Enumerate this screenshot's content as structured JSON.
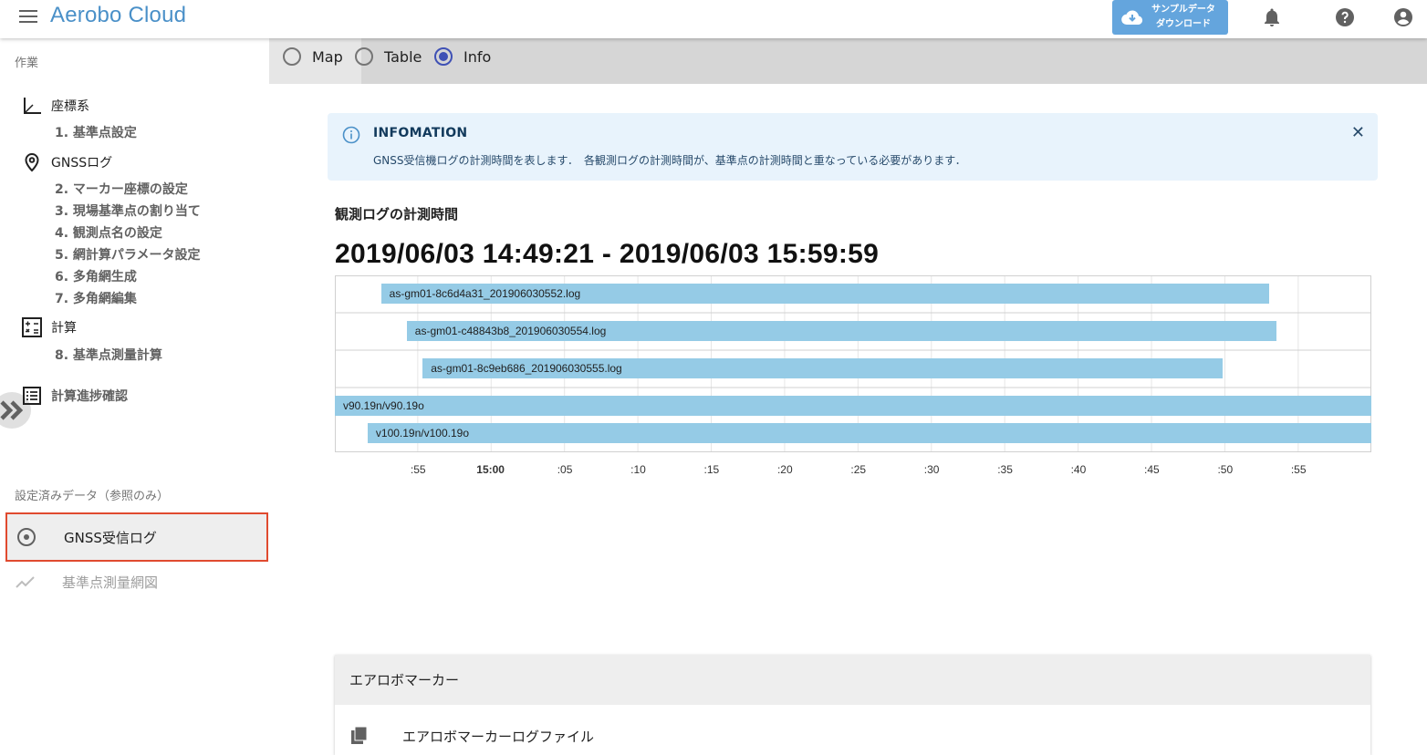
{
  "app": {
    "title": "Aerobo Cloud"
  },
  "header": {
    "download_line1": "サンプルデータ",
    "download_line2": "ダウンロード"
  },
  "sidebar": {
    "section_work": "作業",
    "groups": [
      {
        "label": "座標系",
        "icon": "axis-icon"
      },
      {
        "label": "GNSSログ",
        "icon": "location-pin-icon"
      },
      {
        "label": "計算",
        "icon": "calculator-icon"
      },
      {
        "label": "計算進捗確認",
        "icon": "list-icon"
      }
    ],
    "steps": [
      "1. 基準点設定",
      "2. マーカー座標の設定",
      "3. 現場基準点の割り当て",
      "4. 観測点名の設定",
      "5. 網計算パラメータ設定",
      "6. 多角網生成",
      "7. 多角網編集",
      "8. 基準点測量計算"
    ],
    "section_reference": "設定済みデータ（参照のみ）",
    "reference_items": [
      {
        "label": "GNSS受信ログ",
        "icon": "radio-target-icon"
      },
      {
        "label": "基準点測量網図",
        "icon": "trend-line-icon"
      }
    ]
  },
  "view_switch": {
    "options": [
      "Map",
      "Table",
      "Info"
    ],
    "selected": "Info"
  },
  "alert": {
    "title": "INFOMATION",
    "message": "GNSS受信機ログの計測時間を表します．　各観測ログの計測時間が、基準点の計測時間と重なっている必要があります．"
  },
  "chart_heading": "観測ログの計測時間",
  "time_range": "2019/06/03 14:49:21 - 2019/06/03 15:59:59",
  "chart_data": {
    "type": "timeline",
    "x_axis": {
      "ticks": [
        ":55",
        "15:00",
        ":05",
        ":10",
        ":15",
        ":20",
        ":25",
        ":30",
        ":35",
        ":40",
        ":45",
        ":50",
        ":55"
      ],
      "range": [
        "14:49:21",
        "15:59:59"
      ]
    },
    "series": [
      {
        "label": "as-gm01-8c6d4a31_201906030552.log",
        "start": "14:52:30",
        "end": "15:53:00",
        "color": "#95cbe6"
      },
      {
        "label": "as-gm01-c48843b8_201906030554.log",
        "start": "14:54:15",
        "end": "15:53:30",
        "color": "#95cbe6"
      },
      {
        "label": "as-gm01-8c9eb686_201906030555.log",
        "start": "14:55:20",
        "end": "15:49:50",
        "color": "#95cbe6"
      },
      {
        "label": "v90.19n/v90.19o",
        "start": "14:49:21",
        "end": "15:59:59",
        "color": "#95cbe6"
      },
      {
        "label": "v100.19n/v100.19o",
        "start": "14:51:35",
        "end": "15:59:59",
        "color": "#95cbe6"
      }
    ]
  },
  "marker_card": {
    "title": "エアロボマーカー",
    "row_label": "エアロボマーカーログファイル"
  },
  "colors": {
    "brand": "#4a90c8",
    "bar": "#95cbe6",
    "radio_selected": "#3f51b5",
    "highlight_border": "#e04a2f"
  }
}
